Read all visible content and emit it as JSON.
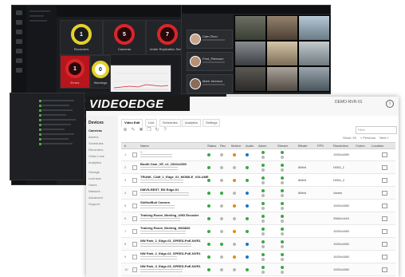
{
  "dark_dashboard": {
    "title": "",
    "kpis": [
      {
        "value": "1",
        "label": "Recorders",
        "style": "yellow"
      },
      {
        "value": "5",
        "label": "Cameras",
        "style": "red"
      },
      {
        "value": "7",
        "label": "Under Replication Server",
        "style": "red-tile"
      },
      {
        "value": "1",
        "label": "Errors",
        "style": "red"
      },
      {
        "value": "0",
        "label": "Warnings",
        "style": "light"
      },
      {
        "value": "0",
        "label": "Info",
        "style": "light"
      }
    ]
  },
  "camera_view": {
    "cards": [
      {
        "name": "Cam Zhou"
      },
      {
        "name": "Fred_Peterson"
      },
      {
        "name": "Mark Johnson"
      }
    ]
  },
  "videoedge": {
    "logo": "VIDEOEDGE",
    "user": "DEMO-NVR-01",
    "sidebar": {
      "section": "Devices",
      "items": [
        "Cameras",
        "Alarms",
        "Schedules",
        "Recorders",
        "Video Loss",
        "Analytics",
        "Storage",
        "Licenses",
        "Users",
        "Network",
        "Advanced",
        "Support"
      ],
      "active_index": 0
    },
    "tabs": [
      "Video Edit",
      "Live",
      "Schedules",
      "Analytics",
      "Settings"
    ],
    "search_placeholder": "Filter",
    "paging": [
      "Show: 25",
      "« Previous",
      "Next »"
    ],
    "columns": [
      "#",
      "Name",
      "Status",
      "Rec",
      "Motion",
      "Audio",
      "Alarm",
      "Stream",
      "Bitrate",
      "FPS",
      "Resolution",
      "Codec",
      "Location",
      ""
    ],
    "rows": [
      {
        "num": "1",
        "name": "...",
        "v1": "",
        "v2": "1920x1080"
      },
      {
        "num": "2",
        "name": "Booth Cam_VE_v1_1920x1080",
        "v1": "8Mbit",
        "v2": "H264_1"
      },
      {
        "num": "3",
        "name": "TRUNK_CAM_1_Edge_01_MOBILE_VOLUME",
        "v1": "6Mbit",
        "v2": "H264_2"
      },
      {
        "num": "4",
        "name": "DMVS-REST_RD Edge-01",
        "v1": "8Mbit",
        "v2": "Varies"
      },
      {
        "num": "5",
        "name": "ShiftedBull Camera",
        "v1": "",
        "v2": "1920x1080"
      },
      {
        "num": "6",
        "name": "Training Room_Meeting_UHD Encoder",
        "v1": "",
        "v2": "2560x1440"
      },
      {
        "num": "7",
        "name": "Training Room_Meeting_MX8826",
        "v1": "",
        "v2": "1920x1080"
      },
      {
        "num": "8",
        "name": "NW Park_1_Edge-01_SPEED-PoE-NVR1",
        "v1": "",
        "v2": "1920x1080"
      },
      {
        "num": "9",
        "name": "NW Park_2_Edge-02_SPEED-PoE-NVR1",
        "v1": "",
        "v2": "1920x1080"
      },
      {
        "num": "10",
        "name": "NW Park_3_Edge-03_SPEED-PoE-NVR1",
        "v1": "",
        "v2": "1920x1080"
      },
      {
        "num": "11",
        "name": "NW Park_4_Edge-04_SPEED-PoE-NVR1",
        "v1": "",
        "v2": "1920x1080"
      }
    ]
  }
}
